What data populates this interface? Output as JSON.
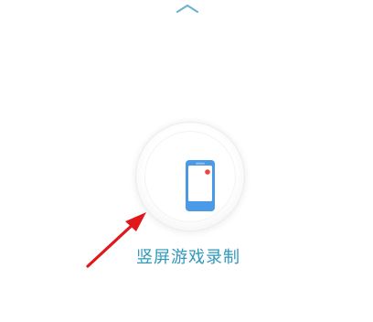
{
  "icons": {
    "top": "chevron-up-icon",
    "main": "phone-record-icon",
    "annotation": "red-arrow-icon"
  },
  "action": {
    "label": "竖屏游戏录制"
  },
  "colors": {
    "accent": "#2f98bb",
    "icon_blue": "#4a9ae8",
    "record_red": "#ef4444",
    "arrow_red": "#e0181b"
  }
}
